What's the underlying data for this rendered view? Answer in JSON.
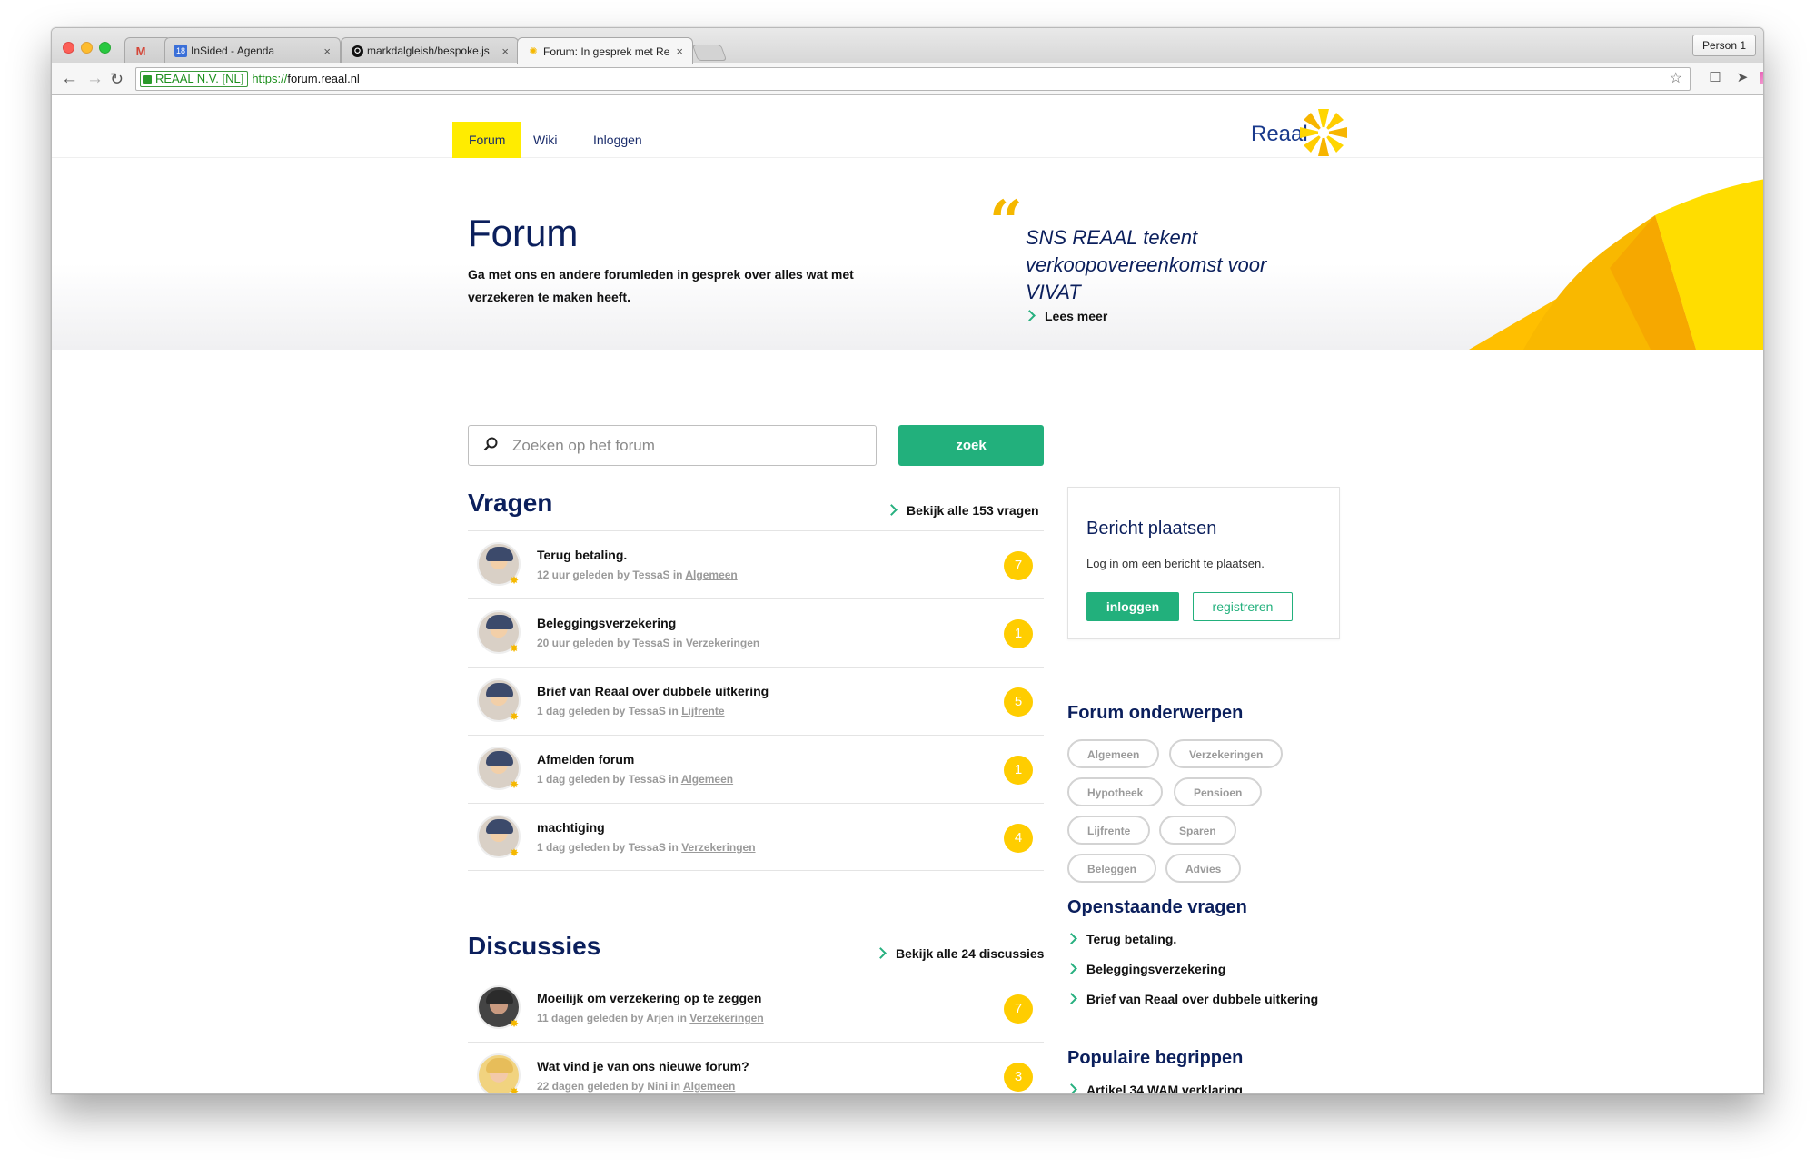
{
  "browser": {
    "tabs": [
      {
        "icon": "gmail-icon",
        "label": ""
      },
      {
        "icon": "calendar-icon",
        "label": "InSided - Agenda"
      },
      {
        "icon": "github-icon",
        "label": "markdalgleish/bespoke.js"
      },
      {
        "icon": "reaal-icon",
        "label": "Forum: In gesprek met Rea"
      }
    ],
    "person": "Person 1",
    "ev_label": "REAAL N.V. [NL]",
    "url_scheme": "https://",
    "url_rest": "forum.reaal.nl",
    "calendar_badge": "18"
  },
  "site": {
    "nav": [
      "Forum",
      "Wiki",
      "Inloggen"
    ],
    "logo_text": "Reaal"
  },
  "hero": {
    "title": "Forum",
    "subtitle": "Ga met ons en andere forumleden in gesprek over alles wat met verzekeren te maken heeft.",
    "quote": "SNS REAAL tekent verkoopovereenkomst voor VIVAT",
    "quote_link": "Lees meer"
  },
  "search": {
    "placeholder": "Zoeken op het forum",
    "button": "zoek"
  },
  "vragen": {
    "title": "Vragen",
    "link": "Bekijk alle 153 vragen",
    "items": [
      {
        "title": "Terug betaling.",
        "time": "12 uur geleden by TessaS in",
        "category": "Algemeen",
        "count": "7"
      },
      {
        "title": "Beleggingsverzekering",
        "time": "20 uur geleden by TessaS in",
        "category": "Verzekeringen",
        "count": "1"
      },
      {
        "title": "Brief van Reaal over dubbele uitkering",
        "time": "1 dag geleden by TessaS in",
        "category": "Lijfrente",
        "count": "5"
      },
      {
        "title": "Afmelden forum",
        "time": "1 dag geleden by TessaS in",
        "category": "Algemeen",
        "count": "1"
      },
      {
        "title": "machtiging",
        "time": "1 dag geleden by TessaS in",
        "category": "Verzekeringen",
        "count": "4"
      }
    ]
  },
  "discussies": {
    "title": "Discussies",
    "link": "Bekijk alle 24 discussies",
    "items": [
      {
        "title": "Moeilijk om verzekering op te zeggen",
        "time": "11 dagen geleden by Arjen in",
        "category": "Verzekeringen",
        "count": "7"
      },
      {
        "title": "Wat vind je van ons nieuwe forum?",
        "time": "22 dagen geleden by Nini in",
        "category": "Algemeen",
        "count": "3"
      }
    ]
  },
  "sidebar": {
    "post_title": "Bericht plaatsen",
    "post_text": "Log in om een bericht te plaatsen.",
    "login": "inloggen",
    "register": "registreren",
    "topics_title": "Forum onderwerpen",
    "topics": [
      "Algemeen",
      "Verzekeringen",
      "Hypotheek",
      "Pensioen",
      "Lijfrente",
      "Sparen",
      "Beleggen",
      "Advies"
    ],
    "open_title": "Openstaande vragen",
    "open_items": [
      "Terug betaling.",
      "Beleggingsverzekering",
      "Brief van Reaal over dubbele uitkering"
    ],
    "popular_title": "Populaire begrippen",
    "popular_items": [
      "Artikel 34 WAM verklaring"
    ]
  },
  "colors": {
    "brand_navy": "#0b1f5c",
    "accent_green": "#22b07c",
    "accent_yellow": "#ffcd00"
  }
}
